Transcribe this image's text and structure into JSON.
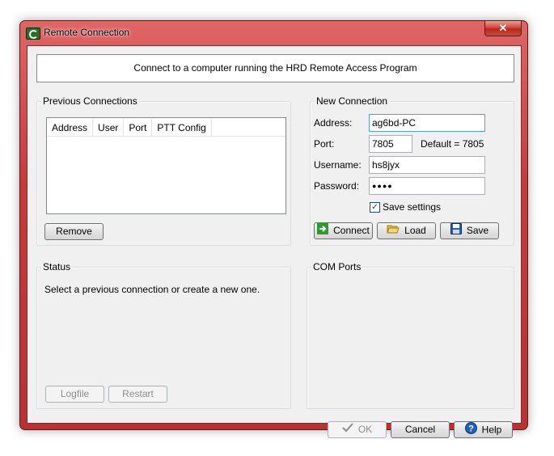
{
  "window": {
    "title": "Remote Connection",
    "close_glyph": "✕"
  },
  "banner": {
    "text": "Connect to a computer running the HRD Remote Access Program"
  },
  "previous": {
    "title": "Previous Connections",
    "columns": [
      "Address",
      "User",
      "Port",
      "PTT Config"
    ],
    "remove_label": "Remove"
  },
  "new_conn": {
    "title": "New Connection",
    "address_label": "Address:",
    "address_value": "ag6bd-PC",
    "port_label": "Port:",
    "port_value": "7805",
    "port_default": "Default = 7805",
    "username_label": "Username:",
    "username_value": "hs8jyx",
    "password_label": "Password:",
    "password_value": "●●●●",
    "save_settings_label": "Save settings",
    "save_settings_checked": true,
    "connect_label": "Connect",
    "load_label": "Load",
    "save_label": "Save"
  },
  "status": {
    "title": "Status",
    "message": "Select a previous connection or create a new one.",
    "logfile_label": "Logfile",
    "restart_label": "Restart"
  },
  "com_ports": {
    "title": "COM Ports"
  },
  "footer": {
    "ok_label": "OK",
    "cancel_label": "Cancel",
    "help_label": "Help"
  },
  "icons": {
    "app": "hrd-logo-icon",
    "connect": "arrow-right-icon",
    "load": "folder-open-icon",
    "save": "floppy-disk-icon",
    "ok": "checkmark-icon",
    "help": "question-icon"
  },
  "colors": {
    "frame": "#c73a3a",
    "dialog_bg": "#f0f0f0",
    "connect_icon": "#2e9b2e",
    "help_icon": "#1f5fbf"
  }
}
